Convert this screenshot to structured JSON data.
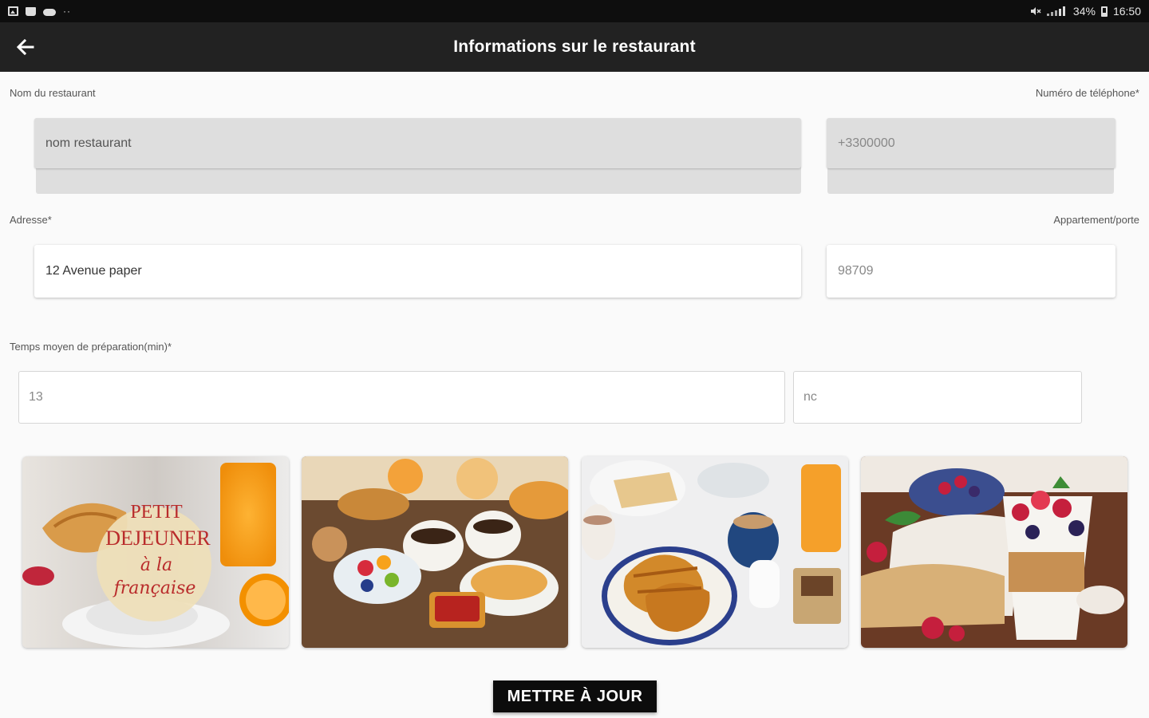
{
  "status_bar": {
    "left_icons": [
      "image-icon",
      "bag-icon",
      "cloud-icon",
      "more-dots-icon"
    ],
    "dots": "··",
    "battery": "34%",
    "time": "16:50"
  },
  "app_bar": {
    "title": "Informations sur le restaurant",
    "back_icon": "arrow-left-icon"
  },
  "form": {
    "restaurant_name": {
      "label": "Nom du restaurant",
      "value": "nom restaurant",
      "disabled": true
    },
    "phone": {
      "label": "Numéro de téléphone*",
      "value": "+3300000",
      "disabled": true
    },
    "address": {
      "label": "Adresse*",
      "value": "12 Avenue paper"
    },
    "apartment": {
      "label": "Appartement/porte",
      "value": "98709"
    },
    "prep_time": {
      "label": "Temps moyen de préparation(min)*",
      "value": "13"
    },
    "extra": {
      "value": "nc"
    }
  },
  "gallery": {
    "images": [
      {
        "name": "petit-dejeuner-image",
        "text_line1": "PETIT",
        "text_line2": "DEJEUNER",
        "text_line3": "à la",
        "text_line4": "française"
      },
      {
        "name": "breakfast-spread-image"
      },
      {
        "name": "croissants-coffee-image"
      },
      {
        "name": "yogurt-parfait-image"
      }
    ]
  },
  "actions": {
    "update_label": "METTRE À JOUR"
  },
  "colors": {
    "app_bar": "#222222",
    "status_bar": "#0e0e0e",
    "background": "#fafafa",
    "disabled_field": "#dedede",
    "button": "#0c0c0c"
  }
}
